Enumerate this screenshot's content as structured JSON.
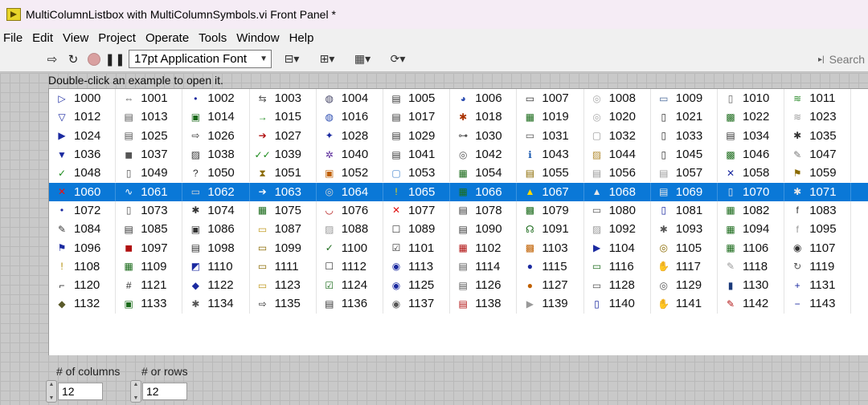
{
  "window": {
    "title": "MultiColumnListbox with MultiColumnSymbols.vi Front Panel *"
  },
  "menu": [
    "File",
    "Edit",
    "View",
    "Project",
    "Operate",
    "Tools",
    "Window",
    "Help"
  ],
  "toolbar": {
    "font": "17pt Application Font",
    "search_placeholder": "Search"
  },
  "hint": "Double-click an example to open it.",
  "listbox": {
    "selected_row": 5,
    "rows": [
      [
        {
          "n": "1000",
          "i": "run-arrow-icon",
          "g": "▷",
          "c": "#1b2aa0"
        },
        {
          "n": "1001",
          "i": "network-icon",
          "g": "⇔",
          "c": "#555"
        },
        {
          "n": "1002",
          "i": "dot-icon",
          "g": "•",
          "c": "#1b2aa0"
        },
        {
          "n": "1003",
          "i": "connector-icon",
          "g": "⇆",
          "c": "#555"
        },
        {
          "n": "1004",
          "i": "globe-icon",
          "g": "◍",
          "c": "#446"
        },
        {
          "n": "1005",
          "i": "printer-icon",
          "g": "▤",
          "c": "#333"
        },
        {
          "n": "1006",
          "i": "palette-icon",
          "g": "◕",
          "c": "#2a4bb0"
        },
        {
          "n": "1007",
          "i": "camera-icon",
          "g": "▭",
          "c": "#333"
        },
        {
          "n": "1008",
          "i": "cd-icon",
          "g": "◎",
          "c": "#aaa"
        },
        {
          "n": "1009",
          "i": "folder-icon",
          "g": "▭",
          "c": "#4a6a9a"
        },
        {
          "n": "1010",
          "i": "tablet-icon",
          "g": "▯",
          "c": "#666"
        },
        {
          "n": "1011",
          "i": "wireless-icon",
          "g": "≋",
          "c": "#2a8a2a"
        }
      ],
      [
        {
          "n": "1012",
          "i": "down-triangle-icon",
          "g": "▽",
          "c": "#1b2aa0"
        },
        {
          "n": "1013",
          "i": "server-icon",
          "g": "▤",
          "c": "#555"
        },
        {
          "n": "1014",
          "i": "vi-dot-icon",
          "g": "▣",
          "c": "#1a6a1a"
        },
        {
          "n": "1015",
          "i": "right-arrow-icon",
          "g": "→",
          "c": "#1a8a1a"
        },
        {
          "n": "1016",
          "i": "globe-icon",
          "g": "◍",
          "c": "#2a4bb0"
        },
        {
          "n": "1017",
          "i": "document-icon",
          "g": "▤",
          "c": "#333"
        },
        {
          "n": "1018",
          "i": "robot-icon",
          "g": "✱",
          "c": "#aa3300"
        },
        {
          "n": "1019",
          "i": "chart-icon",
          "g": "▦",
          "c": "#1a6a1a"
        },
        {
          "n": "1020",
          "i": "cd-icon",
          "g": "◎",
          "c": "#aaa"
        },
        {
          "n": "1021",
          "i": "phone-icon",
          "g": "▯",
          "c": "#333"
        },
        {
          "n": "1022",
          "i": "device-icon",
          "g": "▩",
          "c": "#1a6a1a"
        },
        {
          "n": "1023",
          "i": "wireless-icon",
          "g": "≋",
          "c": "#999"
        }
      ],
      [
        {
          "n": "1024",
          "i": "play-icon",
          "g": "▶",
          "c": "#1b2aa0"
        },
        {
          "n": "1025",
          "i": "server-icon",
          "g": "▤",
          "c": "#555"
        },
        {
          "n": "1026",
          "i": "hollow-arrow-icon",
          "g": "⇨",
          "c": "#333"
        },
        {
          "n": "1027",
          "i": "small-arrow-icon",
          "g": "➔",
          "c": "#b01010"
        },
        {
          "n": "1028",
          "i": "compass-icon",
          "g": "✦",
          "c": "#1b2aa0"
        },
        {
          "n": "1029",
          "i": "document-icon",
          "g": "▤",
          "c": "#333"
        },
        {
          "n": "1030",
          "i": "plug-icon",
          "g": "⊶",
          "c": "#555"
        },
        {
          "n": "1031",
          "i": "keyboard-icon",
          "g": "▭",
          "c": "#555"
        },
        {
          "n": "1032",
          "i": "blank-icon",
          "g": "▢",
          "c": "#999"
        },
        {
          "n": "1033",
          "i": "phone-icon",
          "g": "▯",
          "c": "#333"
        },
        {
          "n": "1034",
          "i": "fuel-icon",
          "g": "▤",
          "c": "#333"
        },
        {
          "n": "1035",
          "i": "antenna-icon",
          "g": "✱",
          "c": "#333"
        }
      ],
      [
        {
          "n": "1036",
          "i": "down-arrow-icon",
          "g": "▼",
          "c": "#1b2aa0"
        },
        {
          "n": "1037",
          "i": "cube-icon",
          "g": "◼",
          "c": "#555"
        },
        {
          "n": "1038",
          "i": "image-icon",
          "g": "▨",
          "c": "#333"
        },
        {
          "n": "1039",
          "i": "double-check-icon",
          "g": "✓✓",
          "c": "#1a8a1a"
        },
        {
          "n": "1040",
          "i": "gear-icon",
          "g": "✲",
          "c": "#5a2a9a"
        },
        {
          "n": "1041",
          "i": "document-icon",
          "g": "▤",
          "c": "#333"
        },
        {
          "n": "1042",
          "i": "target-icon",
          "g": "◎",
          "c": "#555"
        },
        {
          "n": "1043",
          "i": "info-icon",
          "g": "ℹ",
          "c": "#1b5ab0"
        },
        {
          "n": "1044",
          "i": "image-icon",
          "g": "▨",
          "c": "#b08a30"
        },
        {
          "n": "1045",
          "i": "phone-icon",
          "g": "▯",
          "c": "#333"
        },
        {
          "n": "1046",
          "i": "mixer-icon",
          "g": "▩",
          "c": "#1a6a1a"
        },
        {
          "n": "1047",
          "i": "edit-icon",
          "g": "✎",
          "c": "#777"
        }
      ],
      [
        {
          "n": "1048",
          "i": "check-icon",
          "g": "✓",
          "c": "#1a8a1a"
        },
        {
          "n": "1049",
          "i": "battery-icon",
          "g": "▯",
          "c": "#555"
        },
        {
          "n": "1050",
          "i": "question-icon",
          "g": "?",
          "c": "#333"
        },
        {
          "n": "1051",
          "i": "hourglass-icon",
          "g": "⧗",
          "c": "#8a6a00"
        },
        {
          "n": "1052",
          "i": "fire-icon",
          "g": "▣",
          "c": "#c06000"
        },
        {
          "n": "1053",
          "i": "empty-box-icon",
          "g": "▢",
          "c": "#4a8ad0"
        },
        {
          "n": "1054",
          "i": "waveform-icon",
          "g": "▦",
          "c": "#1a6a1a"
        },
        {
          "n": "1055",
          "i": "script-icon",
          "g": "▤",
          "c": "#8a6a00"
        },
        {
          "n": "1056",
          "i": "file-icon",
          "g": "▤",
          "c": "#999"
        },
        {
          "n": "1057",
          "i": "notepad-icon",
          "g": "▤",
          "c": "#999"
        },
        {
          "n": "1058",
          "i": "tools-icon",
          "g": "✕",
          "c": "#1b2aa0"
        },
        {
          "n": "1059",
          "i": "flag-icon",
          "g": "⚑",
          "c": "#8a6a00"
        }
      ],
      [
        {
          "n": "1060",
          "i": "error-x-icon",
          "g": "✕",
          "c": "#e01010"
        },
        {
          "n": "1061",
          "i": "sine-icon",
          "g": "∿",
          "c": "#fff"
        },
        {
          "n": "1062",
          "i": "drive-icon",
          "g": "▭",
          "c": "#ccc"
        },
        {
          "n": "1063",
          "i": "right-arrow-icon",
          "g": "➔",
          "c": "#fff"
        },
        {
          "n": "1064",
          "i": "dial-icon",
          "g": "◎",
          "c": "#ccc"
        },
        {
          "n": "1065",
          "i": "warning-icon",
          "g": "!",
          "c": "#f0d000"
        },
        {
          "n": "1066",
          "i": "scope-icon",
          "g": "▦",
          "c": "#1a6a1a"
        },
        {
          "n": "1067",
          "i": "triangle-warning-icon",
          "g": "▲",
          "c": "#f0d000"
        },
        {
          "n": "1068",
          "i": "triangle-info-icon",
          "g": "▲",
          "c": "#ddd"
        },
        {
          "n": "1069",
          "i": "notepad-icon",
          "g": "▤",
          "c": "#ddd"
        },
        {
          "n": "1070",
          "i": "phone-icon",
          "g": "▯",
          "c": "#ddd"
        },
        {
          "n": "1071",
          "i": "ribbon-icon",
          "g": "✱",
          "c": "#ddd"
        }
      ],
      [
        {
          "n": "1072",
          "i": "dot-icon",
          "g": "•",
          "c": "#1b2aa0"
        },
        {
          "n": "1073",
          "i": "battery-icon",
          "g": "▯",
          "c": "#555"
        },
        {
          "n": "1074",
          "i": "robot-icon",
          "g": "✱",
          "c": "#333"
        },
        {
          "n": "1075",
          "i": "chip-icon",
          "g": "▦",
          "c": "#1a6a1a"
        },
        {
          "n": "1076",
          "i": "mouth-icon",
          "g": "◡",
          "c": "#b01010"
        },
        {
          "n": "1077",
          "i": "stop-icon",
          "g": "✕",
          "c": "#e01010"
        },
        {
          "n": "1078",
          "i": "can-icon",
          "g": "▤",
          "c": "#333"
        },
        {
          "n": "1079",
          "i": "board-icon",
          "g": "▩",
          "c": "#1a6a1a"
        },
        {
          "n": "1080",
          "i": "monitor-icon",
          "g": "▭",
          "c": "#555"
        },
        {
          "n": "1081",
          "i": "phone-icon",
          "g": "▯",
          "c": "#1b2aa0"
        },
        {
          "n": "1082",
          "i": "scope-icon",
          "g": "▦",
          "c": "#1a6a1a"
        },
        {
          "n": "1083",
          "i": "function-icon",
          "g": "f",
          "c": "#333"
        }
      ],
      [
        {
          "n": "1084",
          "i": "tools-icon",
          "g": "✎",
          "c": "#333"
        },
        {
          "n": "1085",
          "i": "numbers-icon",
          "g": "▤",
          "c": "#333"
        },
        {
          "n": "1086",
          "i": "film-icon",
          "g": "▣",
          "c": "#333"
        },
        {
          "n": "1087",
          "i": "folder-icon",
          "g": "▭",
          "c": "#c09a20"
        },
        {
          "n": "1088",
          "i": "picture-icon",
          "g": "▨",
          "c": "#999"
        },
        {
          "n": "1089",
          "i": "checkbox-icon",
          "g": "☐",
          "c": "#333"
        },
        {
          "n": "1090",
          "i": "toolbox-icon",
          "g": "▤",
          "c": "#333"
        },
        {
          "n": "1091",
          "i": "antenna-icon",
          "g": "☊",
          "c": "#1a6a1a"
        },
        {
          "n": "1092",
          "i": "image-icon",
          "g": "▨",
          "c": "#999"
        },
        {
          "n": "1093",
          "i": "tools-icon",
          "g": "✱",
          "c": "#555"
        },
        {
          "n": "1094",
          "i": "scope-icon",
          "g": "▦",
          "c": "#1a6a1a"
        },
        {
          "n": "1095",
          "i": "function-icon",
          "g": "f",
          "c": "#999"
        }
      ],
      [
        {
          "n": "1096",
          "i": "flag-icon",
          "g": "⚑",
          "c": "#1b2aa0"
        },
        {
          "n": "1097",
          "i": "cube-icon",
          "g": "◼",
          "c": "#b01010"
        },
        {
          "n": "1098",
          "i": "graph-icon",
          "g": "▤",
          "c": "#333"
        },
        {
          "n": "1099",
          "i": "tag-icon",
          "g": "▭",
          "c": "#8a6a00"
        },
        {
          "n": "1100",
          "i": "mx-icon",
          "g": "✓",
          "c": "#1a6a1a"
        },
        {
          "n": "1101",
          "i": "checked-box-icon",
          "g": "☑",
          "c": "#333"
        },
        {
          "n": "1102",
          "i": "table-icon",
          "g": "▦",
          "c": "#b01010"
        },
        {
          "n": "1103",
          "i": "blocks-icon",
          "g": "▩",
          "c": "#c06000"
        },
        {
          "n": "1104",
          "i": "run-box-icon",
          "g": "▶",
          "c": "#1b2aa0"
        },
        {
          "n": "1105",
          "i": "target-icon",
          "g": "◎",
          "c": "#8a6a00"
        },
        {
          "n": "1106",
          "i": "module-icon",
          "g": "▦",
          "c": "#1a6a1a"
        },
        {
          "n": "1107",
          "i": "camera-icon",
          "g": "◉",
          "c": "#333"
        }
      ],
      [
        {
          "n": "1108",
          "i": "exclamation-icon",
          "g": "!",
          "c": "#b08a00"
        },
        {
          "n": "1109",
          "i": "circuit-icon",
          "g": "▦",
          "c": "#1a6a1a"
        },
        {
          "n": "1110",
          "i": "vi-icon",
          "g": "◩",
          "c": "#1b2aa0"
        },
        {
          "n": "1111",
          "i": "tag-icon",
          "g": "▭",
          "c": "#8a6a00"
        },
        {
          "n": "1112",
          "i": "empty-box-icon",
          "g": "☐",
          "c": "#333"
        },
        {
          "n": "1113",
          "i": "satellite-icon",
          "g": "◉",
          "c": "#1b2aa0"
        },
        {
          "n": "1114",
          "i": "keyboard-icon",
          "g": "▤",
          "c": "#555"
        },
        {
          "n": "1115",
          "i": "person-icon",
          "g": "●",
          "c": "#1b2aa0"
        },
        {
          "n": "1116",
          "i": "monitor-icon",
          "g": "▭",
          "c": "#1a6a1a"
        },
        {
          "n": "1117",
          "i": "hand-icon",
          "g": "✋",
          "c": "#999"
        },
        {
          "n": "1118",
          "i": "edit-icon",
          "g": "✎",
          "c": "#999"
        },
        {
          "n": "1119",
          "i": "cycle-icon",
          "g": "↻",
          "c": "#555"
        }
      ],
      [
        {
          "n": "1120",
          "i": "pipe-icon",
          "g": "⌐",
          "c": "#333"
        },
        {
          "n": "1121",
          "i": "dashed-icon",
          "g": "#",
          "c": "#333"
        },
        {
          "n": "1122",
          "i": "stack-icon",
          "g": "◆",
          "c": "#1b2aa0"
        },
        {
          "n": "1123",
          "i": "folder-icon",
          "g": "▭",
          "c": "#c09a20"
        },
        {
          "n": "1124",
          "i": "checked-box-icon",
          "g": "☑",
          "c": "#1a6a1a"
        },
        {
          "n": "1125",
          "i": "satellite-icon",
          "g": "◉",
          "c": "#1b2aa0"
        },
        {
          "n": "1126",
          "i": "drive-icon",
          "g": "▤",
          "c": "#555"
        },
        {
          "n": "1127",
          "i": "people-icon",
          "g": "●",
          "c": "#c06000"
        },
        {
          "n": "1128",
          "i": "monitor-icon",
          "g": "▭",
          "c": "#555"
        },
        {
          "n": "1129",
          "i": "dial-icon",
          "g": "◎",
          "c": "#555"
        },
        {
          "n": "1130",
          "i": "book-icon",
          "g": "▮",
          "c": "#1b3a7a"
        },
        {
          "n": "1131",
          "i": "plus-icon",
          "g": "+",
          "c": "#1b2aa0"
        }
      ],
      [
        {
          "n": "1132",
          "i": "wrench-icon",
          "g": "◆",
          "c": "#5a5a2a"
        },
        {
          "n": "1133",
          "i": "vi-icon",
          "g": "▣",
          "c": "#1a6a1a"
        },
        {
          "n": "1134",
          "i": "robot-icon",
          "g": "✱",
          "c": "#555"
        },
        {
          "n": "1135",
          "i": "hollow-arrow-icon",
          "g": "⇨",
          "c": "#333"
        },
        {
          "n": "1136",
          "i": "document-icon",
          "g": "▤",
          "c": "#333"
        },
        {
          "n": "1137",
          "i": "satellite-icon",
          "g": "◉",
          "c": "#555"
        },
        {
          "n": "1138",
          "i": "error-doc-icon",
          "g": "▤",
          "c": "#b01010"
        },
        {
          "n": "1139",
          "i": "play-doc-icon",
          "g": "▶",
          "c": "#999"
        },
        {
          "n": "1140",
          "i": "phone-icon",
          "g": "▯",
          "c": "#1b2aa0"
        },
        {
          "n": "1141",
          "i": "hand-icon",
          "g": "✋",
          "c": "#999"
        },
        {
          "n": "1142",
          "i": "pencil-icon",
          "g": "✎",
          "c": "#b01010"
        },
        {
          "n": "1143",
          "i": "minus-icon",
          "g": "−",
          "c": "#1b2aa0"
        }
      ]
    ]
  },
  "controls": {
    "columns": {
      "label": "# of columns",
      "value": "12"
    },
    "rows": {
      "label": "# or rows",
      "value": "12"
    }
  }
}
